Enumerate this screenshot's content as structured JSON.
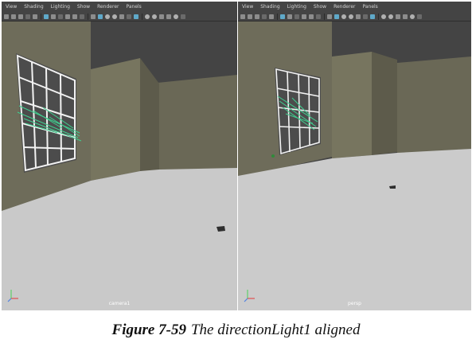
{
  "viewports": [
    {
      "menu": [
        "View",
        "Shading",
        "Lighting",
        "Show",
        "Renderer",
        "Panels"
      ],
      "camera_label": "camera1"
    },
    {
      "menu": [
        "View",
        "Shading",
        "Lighting",
        "Show",
        "Renderer",
        "Panels"
      ],
      "camera_label": "persp"
    }
  ],
  "toolbar_icons": [
    "camera-icon",
    "select-camera-icon",
    "film-gate-icon",
    "bookmark-icon",
    "image-plane-icon",
    "grid-icon",
    "wireframe-icon",
    "smooth-shade-icon",
    "textured-icon",
    "lights-icon",
    "shadows-icon",
    "isolate-icon",
    "xray-icon",
    "resolution-gate-icon"
  ],
  "colors": {
    "viewport_bg": "#444444",
    "wall": "#6e6c5a",
    "floor": "#c9c9c9",
    "light_manipulator": "#3fcf90"
  },
  "caption": {
    "figure": "Figure 7-59",
    "text": "The directionLight1 aligned"
  }
}
